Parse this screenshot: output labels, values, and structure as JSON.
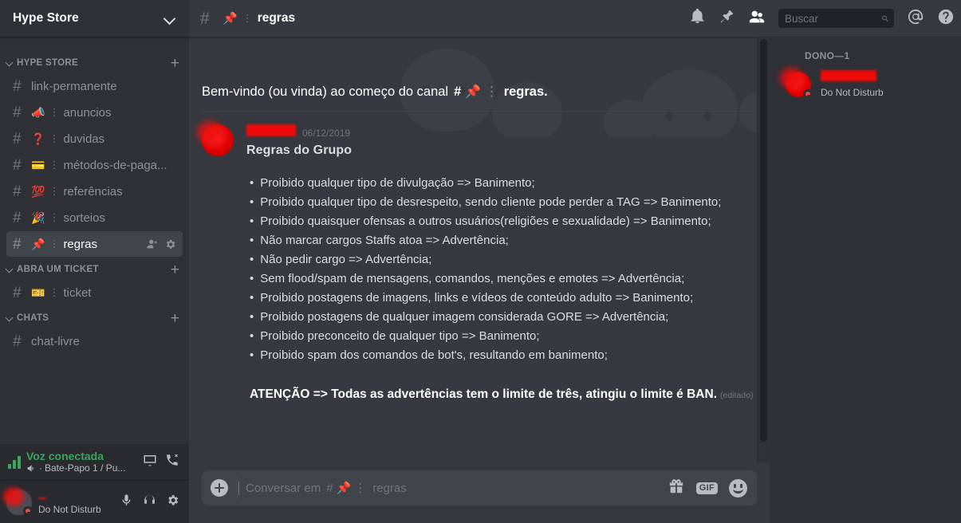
{
  "sidebar": {
    "server_name": "Hype Store",
    "categories": [
      {
        "name": "HYPE STORE",
        "channels": [
          {
            "emoji": "",
            "name": "link-permanente",
            "active": false
          },
          {
            "emoji": "📣",
            "name": "anuncios",
            "active": false
          },
          {
            "emoji": "❓",
            "name": "duvidas",
            "active": false
          },
          {
            "emoji": "💳",
            "name": "métodos-de-paga...",
            "active": false
          },
          {
            "emoji": "💯",
            "name": "referências",
            "active": false
          },
          {
            "emoji": "🎉",
            "name": "sorteios",
            "active": false
          },
          {
            "emoji": "📌",
            "name": "regras",
            "active": true
          }
        ]
      },
      {
        "name": "ABRA UM TICKET",
        "channels": [
          {
            "emoji": "🎫",
            "name": "ticket",
            "active": false
          }
        ]
      },
      {
        "name": "CHATS",
        "channels": [
          {
            "emoji": "",
            "name": "chat-livre",
            "active": false
          }
        ]
      }
    ],
    "voice": {
      "title": "Voz conectada",
      "subtitle": "Bate-Papo 1 / Pu...",
      "separator": "·"
    },
    "user": {
      "name": "",
      "status": "Do Not Disturb"
    }
  },
  "topbar": {
    "hash": "#",
    "channel_emoji": "📌",
    "channel_name": "regras",
    "separator": "⋮"
  },
  "search": {
    "placeholder": "Buscar",
    "value": ""
  },
  "main": {
    "welcome_prefix": "Bem-vindo (ou vinda) ao começo do canal",
    "welcome_hash": "#",
    "welcome_emoji": "📌",
    "welcome_separator": "⋮",
    "welcome_channel": "regras.",
    "message": {
      "author": "",
      "timestamp": "06/12/2019",
      "title": "Regras do Grupo",
      "rules": [
        "Proibido qualquer tipo de divulgação => Banimento;",
        "Proibido qualquer tipo de desrespeito, sendo cliente pode perder a TAG => Banimento;",
        "Proibido quaisquer ofensas a outros usuários(religiões e sexualidade) => Banimento;",
        "Não marcar cargos Staffs atoa => Advertência;",
        "Não pedir cargo => Advertência;",
        "Sem flood/spam de mensagens, comandos, menções e emotes => Advertência;",
        "Proibido postagens de imagens, links e vídeos de conteúdo adulto => Banimento;",
        "Proibido postagens de qualquer imagem considerada GORE => Advertência;",
        "Proibido preconceito de qualquer tipo => Banimento;",
        "Proibido spam dos comandos de bot's, resultando em banimento;"
      ],
      "bullet": "•",
      "attention": "ATENÇÃO => Todas as advertências tem o limite de três, atingiu o limite é BAN.",
      "edited_label": "(editado)"
    }
  },
  "composer": {
    "placeholder_prefix": "Conversar em",
    "placeholder_hash": "#",
    "placeholder_emoji": "📌",
    "placeholder_separator": "⋮",
    "placeholder_channel": "regras",
    "gif_label": "GIF"
  },
  "members": {
    "category": "DONO—1",
    "list": [
      {
        "name": "",
        "status": "Do Not Disturb"
      }
    ]
  },
  "colors": {
    "accent_green": "#3ba55d",
    "dnd_red": "#f04747",
    "sidebar_bg": "#2f3136",
    "chat_bg": "#36393f",
    "active_channel_bg": "#40444b"
  }
}
